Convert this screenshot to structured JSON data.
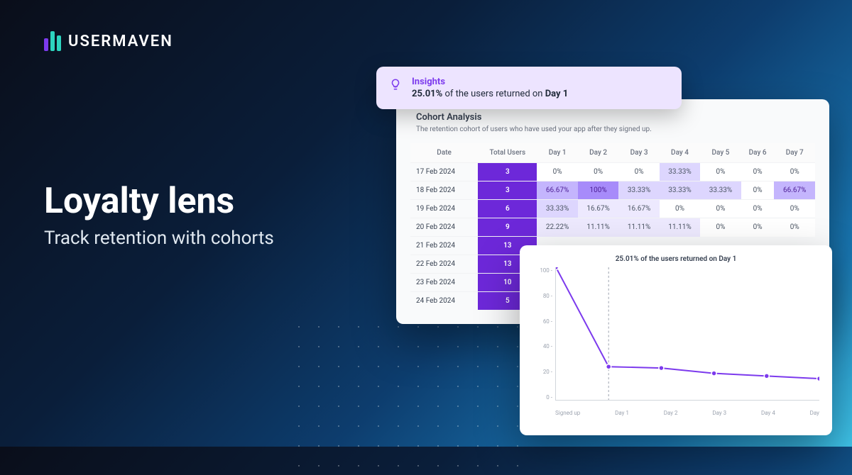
{
  "brand": "USERMAVEN",
  "hero": {
    "title": "Loyalty lens",
    "subtitle": "Track retention with cohorts"
  },
  "insights": {
    "title": "Insights",
    "pct": "25.01%",
    "mid": " of the users returned on ",
    "day": "Day 1"
  },
  "cohort": {
    "title": "Cohort Analysis",
    "subtitle": "The retention cohort of users who have used your app after they signed up.",
    "headers": [
      "Date",
      "Total Users",
      "Day 1",
      "Day 2",
      "Day 3",
      "Day 4",
      "Day 5",
      "Day 6",
      "Day 7"
    ],
    "rows": [
      {
        "date": "17 Feb 2024",
        "total": "3",
        "cells": [
          {
            "v": "0%",
            "s": 0
          },
          {
            "v": "0%",
            "s": 0
          },
          {
            "v": "0%",
            "s": 0
          },
          {
            "v": "33.33%",
            "s": 2
          },
          {
            "v": "0%",
            "s": 0
          },
          {
            "v": "0%",
            "s": 0
          },
          {
            "v": "0%",
            "s": 0
          }
        ]
      },
      {
        "date": "18 Feb 2024",
        "total": "3",
        "cells": [
          {
            "v": "66.67%",
            "s": 3
          },
          {
            "v": "100%",
            "s": 4
          },
          {
            "v": "33.33%",
            "s": 2
          },
          {
            "v": "33.33%",
            "s": 2
          },
          {
            "v": "33.33%",
            "s": 2
          },
          {
            "v": "0%",
            "s": 0
          },
          {
            "v": "66.67%",
            "s": 3
          }
        ]
      },
      {
        "date": "19 Feb 2024",
        "total": "6",
        "cells": [
          {
            "v": "33.33%",
            "s": 2
          },
          {
            "v": "16.67%",
            "s": 1
          },
          {
            "v": "16.67%",
            "s": 1
          },
          {
            "v": "0%",
            "s": 0
          },
          {
            "v": "0%",
            "s": 0
          },
          {
            "v": "0%",
            "s": 0
          },
          {
            "v": "0%",
            "s": 0
          }
        ]
      },
      {
        "date": "20 Feb 2024",
        "total": "9",
        "cells": [
          {
            "v": "22.22%",
            "s": 1
          },
          {
            "v": "11.11%",
            "s": 1
          },
          {
            "v": "11.11%",
            "s": 1
          },
          {
            "v": "11.11%",
            "s": 1
          },
          {
            "v": "0%",
            "s": 0
          },
          {
            "v": "0%",
            "s": 0
          },
          {
            "v": "0%",
            "s": 0
          }
        ]
      },
      {
        "date": "21 Feb 2024",
        "total": "13",
        "cells": []
      },
      {
        "date": "22 Feb 2024",
        "total": "13",
        "cells": []
      },
      {
        "date": "23 Feb 2024",
        "total": "10",
        "cells": []
      },
      {
        "date": "24 Feb 2024",
        "total": "5",
        "cells": []
      }
    ]
  },
  "chart_data": {
    "type": "line",
    "title": "25.01% of the users returned on Day 1",
    "categories": [
      "Signed up",
      "Day 1",
      "Day 2",
      "Day 3",
      "Day 4",
      "Day"
    ],
    "values": [
      100,
      25.01,
      24,
      20,
      18,
      16
    ],
    "ylim": [
      0,
      100
    ],
    "y_ticks": [
      100,
      80,
      60,
      40,
      20,
      0
    ],
    "marker_x_index": 1,
    "xlabel": "",
    "ylabel": ""
  },
  "colors": {
    "shade0": "#ffffff",
    "shade1": "#ede9fe",
    "shade2": "#ddd6fe",
    "shade3": "#c4b5fd",
    "shade4": "#a78bfa",
    "line": "#7c3aed"
  }
}
